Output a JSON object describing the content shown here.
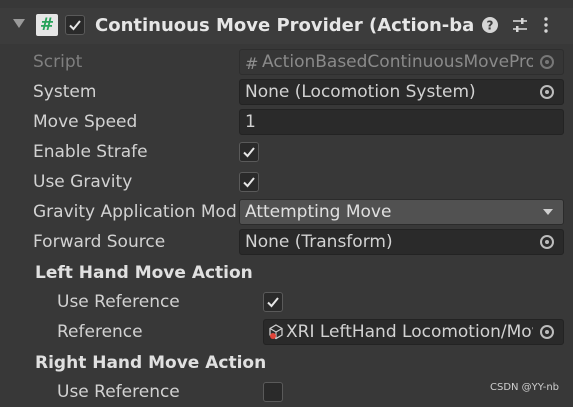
{
  "component": {
    "title": "Continuous Move Provider (Action-based)",
    "enabled": true
  },
  "fields": {
    "script": {
      "label": "Script",
      "value": "ActionBasedContinuousMoveProvider"
    },
    "system": {
      "label": "System",
      "value": "None (Locomotion System)"
    },
    "move_speed": {
      "label": "Move Speed",
      "value": "1"
    },
    "enable_strafe": {
      "label": "Enable Strafe",
      "checked": true
    },
    "use_gravity": {
      "label": "Use Gravity",
      "checked": true
    },
    "gravity_mode": {
      "label": "Gravity Application Mode",
      "value": "Attempting Move"
    },
    "forward_source": {
      "label": "Forward Source",
      "value": "None (Transform)"
    }
  },
  "left_hand": {
    "header": "Left Hand Move Action",
    "use_reference": {
      "label": "Use Reference",
      "checked": true
    },
    "reference": {
      "label": "Reference",
      "value": "XRI LeftHand Locomotion/Move"
    }
  },
  "right_hand": {
    "header": "Right Hand Move Action",
    "use_reference": {
      "label": "Use Reference",
      "checked": false
    }
  },
  "watermark": "CSDN @YY-nb",
  "icons": {
    "fold": "triangle-down-icon",
    "script": "csharp-script-icon",
    "help": "help-icon",
    "presets": "sliders-icon",
    "menu": "kebab-menu-icon",
    "object_picker": "object-picker-icon",
    "input_action_asset": "input-action-icon"
  },
  "colors": {
    "background": "#383838",
    "field": "#2a2a2a",
    "script_icon": "#27a35a",
    "asset_icon_accent": "#e0453a"
  }
}
